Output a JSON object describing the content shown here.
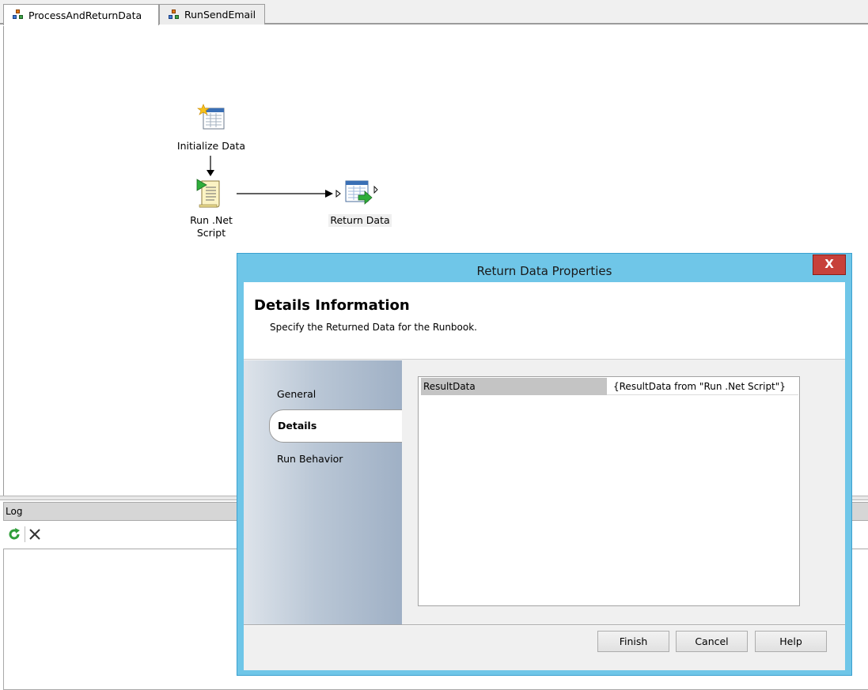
{
  "tabs": [
    {
      "label": "ProcessAndReturnData",
      "active": true
    },
    {
      "label": "RunSendEmail",
      "active": false
    }
  ],
  "canvas": {
    "activities": [
      {
        "label": "Initialize Data",
        "icon": "initialize-data-icon"
      },
      {
        "label": "Run .Net Script",
        "line1": "Run .Net",
        "line2": "Script",
        "icon": "script-icon"
      },
      {
        "label": "Return Data",
        "icon": "return-data-icon"
      }
    ]
  },
  "log": {
    "title": "Log",
    "refresh_icon": "refresh-icon",
    "clear_icon": "close-icon"
  },
  "dialog": {
    "title": "Return Data Properties",
    "close_label": "X",
    "header_title": "Details Information",
    "header_subtitle": "Specify the Returned Data for the Runbook.",
    "nav": [
      {
        "label": "General",
        "active": false
      },
      {
        "label": "Details",
        "active": true
      },
      {
        "label": "Run Behavior",
        "active": false
      }
    ],
    "grid": {
      "rows": [
        {
          "name": "ResultData",
          "value": "{ResultData from \"Run .Net Script\"}"
        }
      ]
    },
    "buttons": {
      "finish": "Finish",
      "cancel": "Cancel",
      "help": "Help"
    }
  },
  "colors": {
    "dialog_frame": "#6fc6e8",
    "close_button": "#c7413a",
    "nav_gradient_end": "#9fb0c5"
  }
}
